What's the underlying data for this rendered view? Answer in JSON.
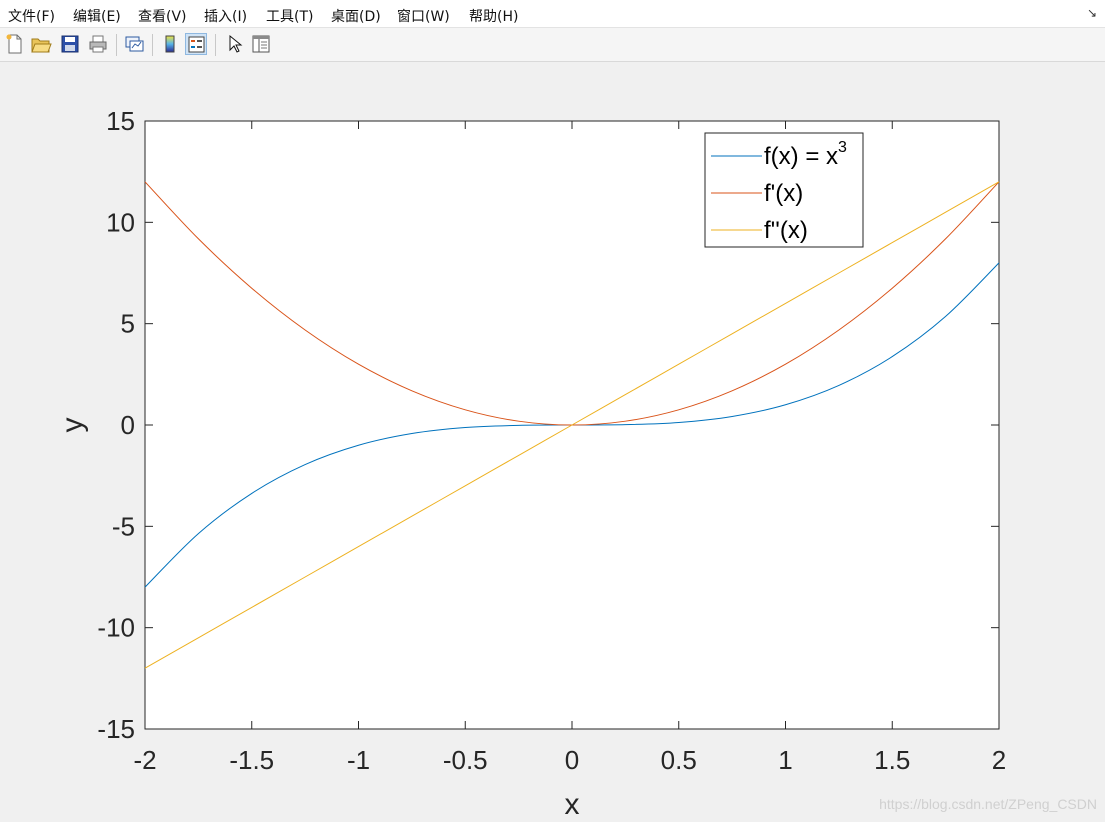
{
  "menubar": {
    "items": [
      "文件(F)",
      "编辑(E)",
      "查看(V)",
      "插入(I)",
      "工具(T)",
      "桌面(D)",
      "窗口(W)",
      "帮助(H)"
    ],
    "corner_glyph": "↘"
  },
  "toolbar": {
    "buttons": [
      {
        "name": "new-figure",
        "icon": "new-file-icon"
      },
      {
        "name": "open-file",
        "icon": "folder-open-icon"
      },
      {
        "name": "save",
        "icon": "save-icon"
      },
      {
        "name": "print",
        "icon": "printer-icon"
      },
      {
        "name": "link-plot",
        "icon": "link-plot-icon"
      },
      {
        "name": "colorbar",
        "icon": "colorbar-icon"
      },
      {
        "name": "legend",
        "icon": "legend-icon",
        "pressed": true
      },
      {
        "name": "edit-plot",
        "icon": "pointer-arrow-icon"
      },
      {
        "name": "property-editor",
        "icon": "property-panel-icon"
      }
    ]
  },
  "watermark": "https://blog.csdn.net/ZPeng_CSDN",
  "chart_data": {
    "type": "line",
    "xlabel": "x",
    "ylabel": "y",
    "xlim": [
      -2,
      2
    ],
    "ylim": [
      -15,
      15
    ],
    "xticks": [
      -2,
      -1.5,
      -1,
      -0.5,
      0,
      0.5,
      1,
      1.5,
      2
    ],
    "xtick_labels": [
      "-2",
      "-1.5",
      "-1",
      "-0.5",
      "0",
      "0.5",
      "1",
      "1.5",
      "2"
    ],
    "yticks": [
      -15,
      -10,
      -5,
      0,
      5,
      10,
      15
    ],
    "ytick_labels": [
      "-15",
      "-10",
      "-5",
      "0",
      "5",
      "10",
      "15"
    ],
    "grid": false,
    "legend_position": "top-right",
    "x": [
      -2,
      -1.75,
      -1.5,
      -1.25,
      -1,
      -0.75,
      -0.5,
      -0.25,
      0,
      0.25,
      0.5,
      0.75,
      1,
      1.25,
      1.5,
      1.75,
      2
    ],
    "series": [
      {
        "name": "f(x) = x",
        "name_superscript": "3",
        "color": "#0072BD",
        "values": [
          -8,
          -5.359,
          -3.375,
          -1.953,
          -1,
          -0.422,
          -0.125,
          -0.016,
          0,
          0.016,
          0.125,
          0.422,
          1,
          1.953,
          3.375,
          5.359,
          8
        ]
      },
      {
        "name": "f'(x)",
        "color": "#D95319",
        "values": [
          12,
          9.188,
          6.75,
          4.688,
          3,
          1.688,
          0.75,
          0.188,
          0,
          0.188,
          0.75,
          1.688,
          3,
          4.688,
          6.75,
          9.188,
          12
        ]
      },
      {
        "name": "f''(x)",
        "color": "#EDB120",
        "values": [
          -12,
          -10.5,
          -9,
          -7.5,
          -6,
          -4.5,
          -3,
          -1.5,
          0,
          1.5,
          3,
          4.5,
          6,
          7.5,
          9,
          10.5,
          12
        ]
      }
    ]
  }
}
